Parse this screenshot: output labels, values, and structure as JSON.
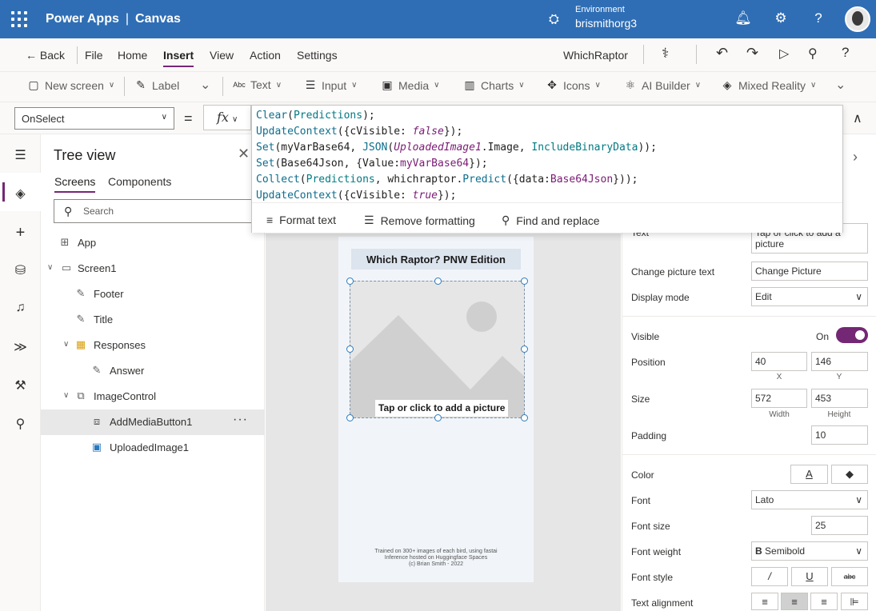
{
  "topbar": {
    "app_name": "Power Apps",
    "separator": "|",
    "mode": "Canvas",
    "env_label": "Environment",
    "env_name": "brismithorg3"
  },
  "cmdbar": {
    "back": "Back",
    "menus": [
      "File",
      "Home",
      "Insert",
      "View",
      "Action",
      "Settings"
    ],
    "app_title": "WhichRaptor"
  },
  "ribbon": {
    "new_screen": "New screen",
    "label": "Label",
    "text": "Text",
    "input": "Input",
    "media": "Media",
    "charts": "Charts",
    "icons": "Icons",
    "ai_builder": "AI Builder",
    "mixed_reality": "Mixed Reality"
  },
  "formula": {
    "property": "OnSelect",
    "equals": "=",
    "fx": "fx",
    "format_text": "Format text",
    "remove_formatting": "Remove formatting",
    "find_replace": "Find and replace"
  },
  "tree": {
    "title": "Tree view",
    "tabs": [
      "Screens",
      "Components"
    ],
    "search_placeholder": "Search",
    "items": [
      "App",
      "Screen1",
      "Footer",
      "Title",
      "Responses",
      "Answer",
      "ImageControl",
      "AddMediaButton1",
      "UploadedImage1"
    ],
    "more": "···"
  },
  "canvas": {
    "app_title": "Which Raptor? PNW Edition",
    "tap_text": "Tap or click to add a picture",
    "footer": [
      "Trained on 300+ images of each bird, using fastai",
      "Inference hosted on Huggingface Spaces",
      "(c) Brian Smith - 2022"
    ]
  },
  "props": {
    "text_label": "Text",
    "text_value": "Tap or click to add a picture",
    "change_label": "Change picture text",
    "change_value": "Change Picture",
    "display_label": "Display mode",
    "display_value": "Edit",
    "visible_label": "Visible",
    "visible_value": "On",
    "position_label": "Position",
    "pos_x": "40",
    "pos_y": "146",
    "x_label": "X",
    "y_label": "Y",
    "size_label": "Size",
    "width": "572",
    "height": "453",
    "width_label": "Width",
    "height_label": "Height",
    "padding_label": "Padding",
    "padding": "10",
    "color_label": "Color",
    "color_text": "A",
    "font_label": "Font",
    "font_value": "Lato",
    "fontsize_label": "Font size",
    "fontsize_value": "25",
    "fontweight_label": "Font weight",
    "fontweight_value": "Semibold",
    "bold_glyph": "B",
    "fontstyle_label": "Font style",
    "italic": "/",
    "underline": "U",
    "strike": "abc",
    "align_label": "Text alignment"
  },
  "colors": {
    "accent": "#742774",
    "topbar": "#2f6eb5",
    "selection": "#2a7abf"
  }
}
